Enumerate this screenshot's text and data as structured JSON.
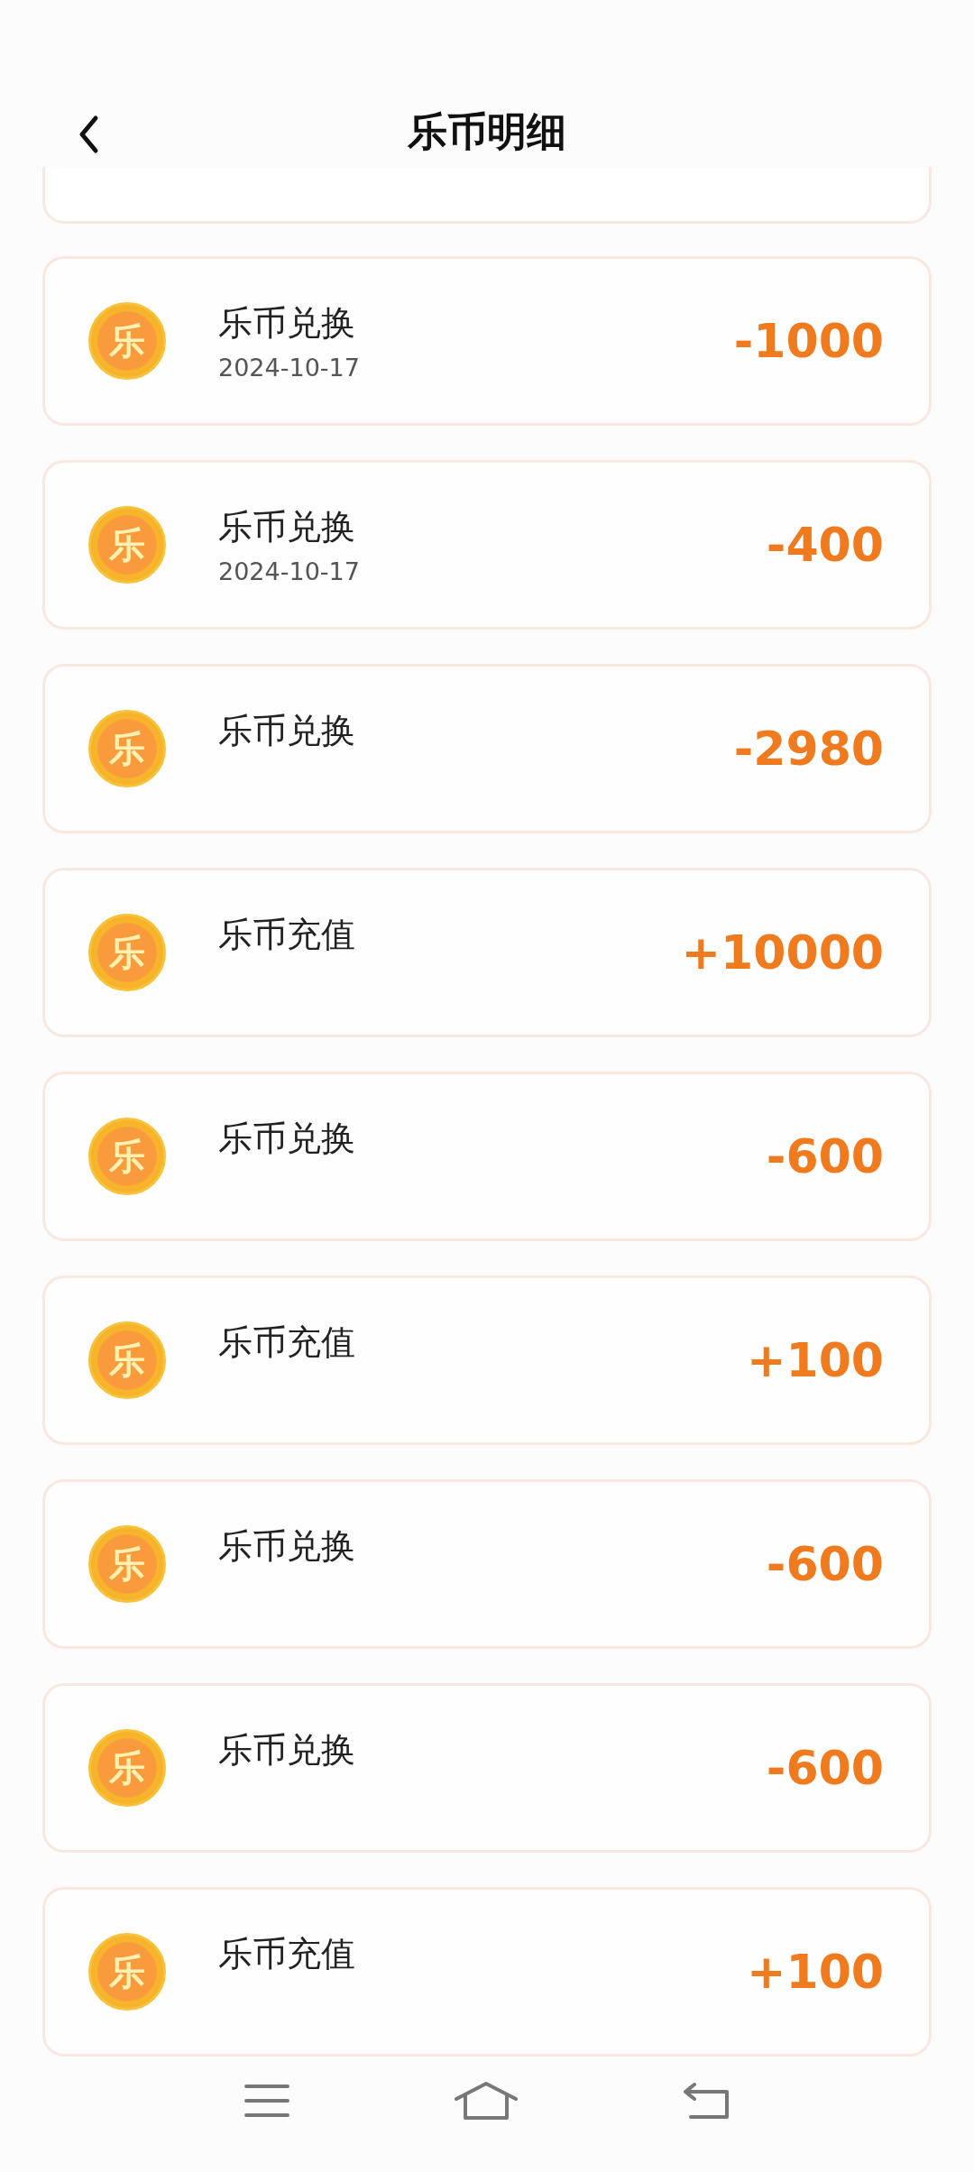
{
  "header": {
    "title": "乐币明细"
  },
  "records": [
    {
      "coin": "乐",
      "title": "乐币兑换",
      "date": "2024-10-17",
      "amount": "-1000"
    },
    {
      "coin": "乐",
      "title": "乐币兑换",
      "date": "2024-10-17",
      "amount": "-400"
    },
    {
      "coin": "乐",
      "title": "乐币兑换",
      "amount": "-2980"
    },
    {
      "coin": "乐",
      "title": "乐币充值",
      "amount": "+10000"
    },
    {
      "coin": "乐",
      "title": "乐币兑换",
      "amount": "-600"
    },
    {
      "coin": "乐",
      "title": "乐币充值",
      "amount": "+100"
    },
    {
      "coin": "乐",
      "title": "乐币兑换",
      "amount": "-600"
    },
    {
      "coin": "乐",
      "title": "乐币兑换",
      "amount": "-600"
    },
    {
      "coin": "乐",
      "title": "乐币充值",
      "amount": "+100"
    }
  ]
}
